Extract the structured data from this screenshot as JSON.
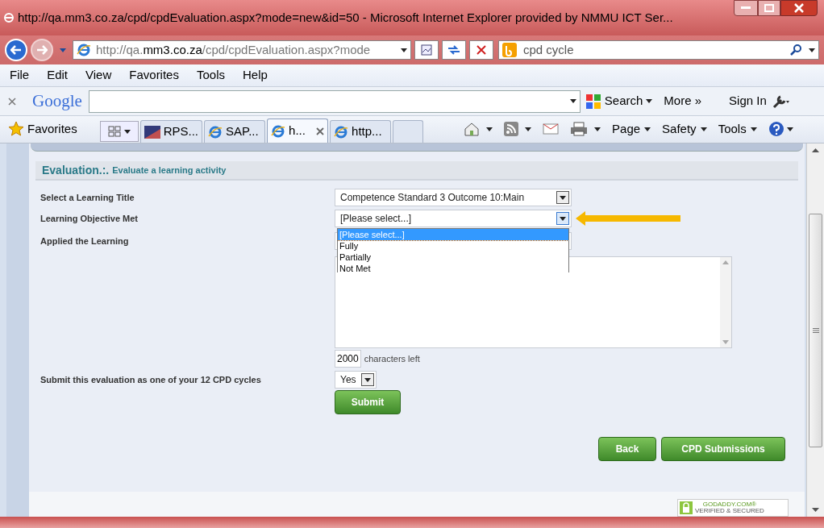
{
  "window": {
    "title": "http://qa.mm3.co.za/cpd/cpdEvaluation.aspx?mode=new&id=50 - Microsoft Internet Explorer provided by NMMU ICT Ser..."
  },
  "address_bar": {
    "url_prefix": "http://qa.",
    "url_domain": "mm3.co.za",
    "url_path": "/cpd/cpdEvaluation.aspx?mode",
    "search_value": "cpd cycle"
  },
  "menu": [
    "File",
    "Edit",
    "View",
    "Favorites",
    "Tools",
    "Help"
  ],
  "google_bar": {
    "logo": "Google",
    "search_button": "Search",
    "more": "More »",
    "sign_in": "Sign In"
  },
  "favorites_bar": {
    "favorites": "Favorites",
    "tabs": [
      {
        "label": "RPS...",
        "selected": false,
        "kind": "rps"
      },
      {
        "label": "SAP...",
        "selected": false,
        "kind": "ie"
      },
      {
        "label": "h...",
        "selected": true,
        "kind": "ie"
      },
      {
        "label": "http...",
        "selected": false,
        "kind": "ie"
      },
      {
        "selected": false,
        "kind": "new"
      }
    ],
    "commands": [
      "Page",
      "Safety",
      "Tools"
    ]
  },
  "page": {
    "heading": "Evaluation.:.",
    "subheading": "Evaluate a learning activity",
    "labels": [
      "Select a Learning Title",
      "Learning Objective Met",
      "Applied the Learning"
    ],
    "learning_title_value": "Competence Standard 3 Outcome 10:Main",
    "objective_value": "[Please select...]",
    "objective_options": [
      {
        "label": "[Please select...]",
        "selected": true
      },
      {
        "label": "Fully",
        "selected": false
      },
      {
        "label": "Partially",
        "selected": false
      },
      {
        "label": "Not Met",
        "selected": false
      }
    ],
    "characters_count": "2000",
    "characters_label": "characters left",
    "submit_label": "Submit this evaluation as one of your 12 CPD cycles",
    "submit_value": "Yes",
    "buttons": {
      "submit": "Submit",
      "back": "Back",
      "submissions": "CPD Submissions"
    },
    "seal": {
      "top": "GODADDY.COM®",
      "bottom": "VERIFIED & SECURED"
    }
  }
}
